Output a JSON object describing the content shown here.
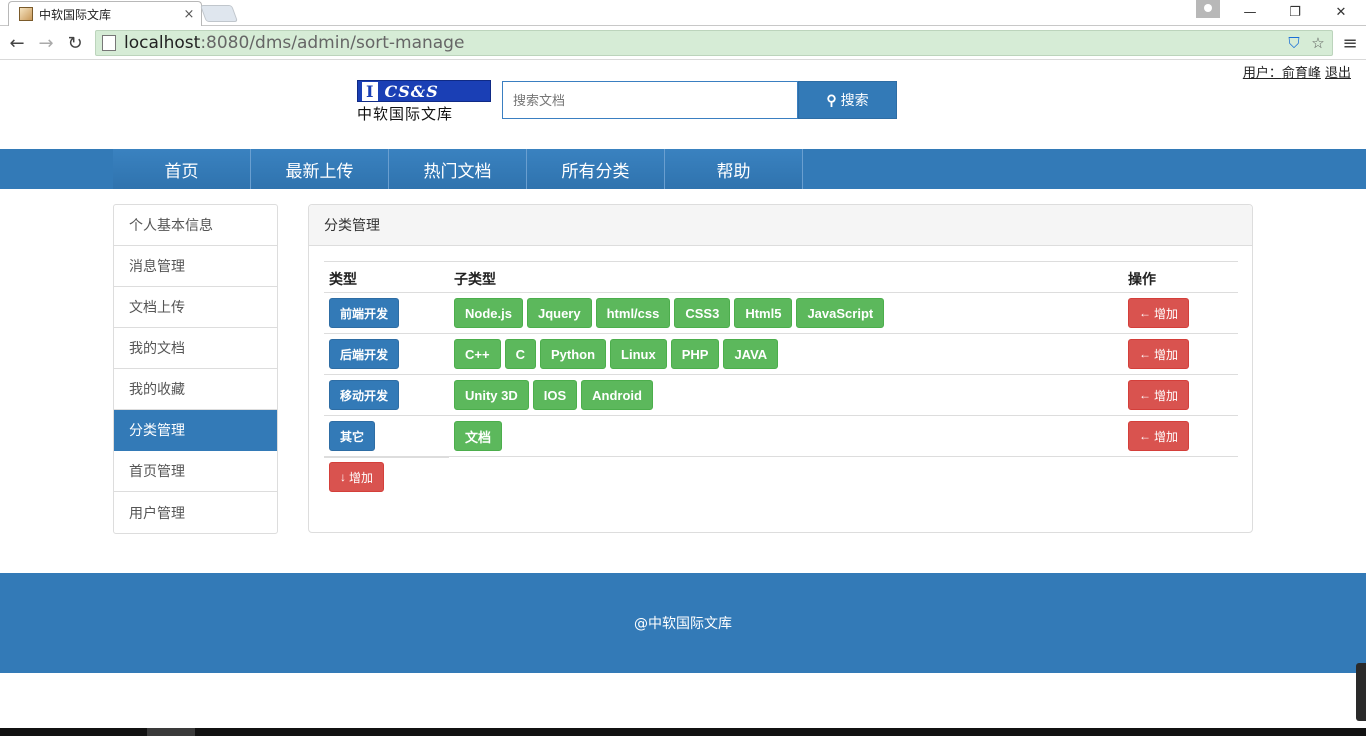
{
  "browser": {
    "tab_title": "中软国际文库",
    "tab_close": "×",
    "url_host": "localhost",
    "url_rest": ":8080/dms/admin/sort-manage",
    "back": "←",
    "forward": "→",
    "reload": "↻",
    "minimize": "—",
    "restore": "❐",
    "close": "✕",
    "menu": "≡",
    "shield": "⛉",
    "star": "☆"
  },
  "header": {
    "user_prefix": "用户：",
    "user_name": "俞育峰",
    "logout": "退出",
    "logo_text_cap": "I",
    "logo_text": "CS&S",
    "logo_cn": "中软国际文库",
    "search_placeholder": "搜索文档",
    "search_glyph": "🔍",
    "search_label": "搜索"
  },
  "nav": {
    "items": [
      "首页",
      "最新上传",
      "热门文档",
      "所有分类",
      "帮助"
    ]
  },
  "sidebar": {
    "items": [
      "个人基本信息",
      "消息管理",
      "文档上传",
      "我的文档",
      "我的收藏",
      "分类管理",
      "首页管理",
      "用户管理"
    ],
    "active_index": 5
  },
  "panel": {
    "title": "分类管理",
    "headers": {
      "type": "类型",
      "subtype": "子类型",
      "action": "操作"
    },
    "rows": [
      {
        "type": "前端开发",
        "subs": [
          "Node.js",
          "Jquery",
          "html/css",
          "CSS3",
          "Html5",
          "JavaScript"
        ],
        "action": "增加"
      },
      {
        "type": "后端开发",
        "subs": [
          "C++",
          "C",
          "Python",
          "Linux",
          "PHP",
          "JAVA"
        ],
        "action": "增加"
      },
      {
        "type": "移动开发",
        "subs": [
          "Unity 3D",
          "IOS",
          "Android"
        ],
        "action": "增加"
      },
      {
        "type": "其它",
        "subs": [
          "文档"
        ],
        "action": "增加"
      }
    ],
    "add_type_label": "增加",
    "left_arrow": "🡐",
    "down_arrow": "🡓"
  },
  "footer": {
    "text": "@中软国际文库"
  },
  "colors": {
    "primary": "#337ab7",
    "success": "#5cb85c",
    "danger": "#d9534f"
  }
}
